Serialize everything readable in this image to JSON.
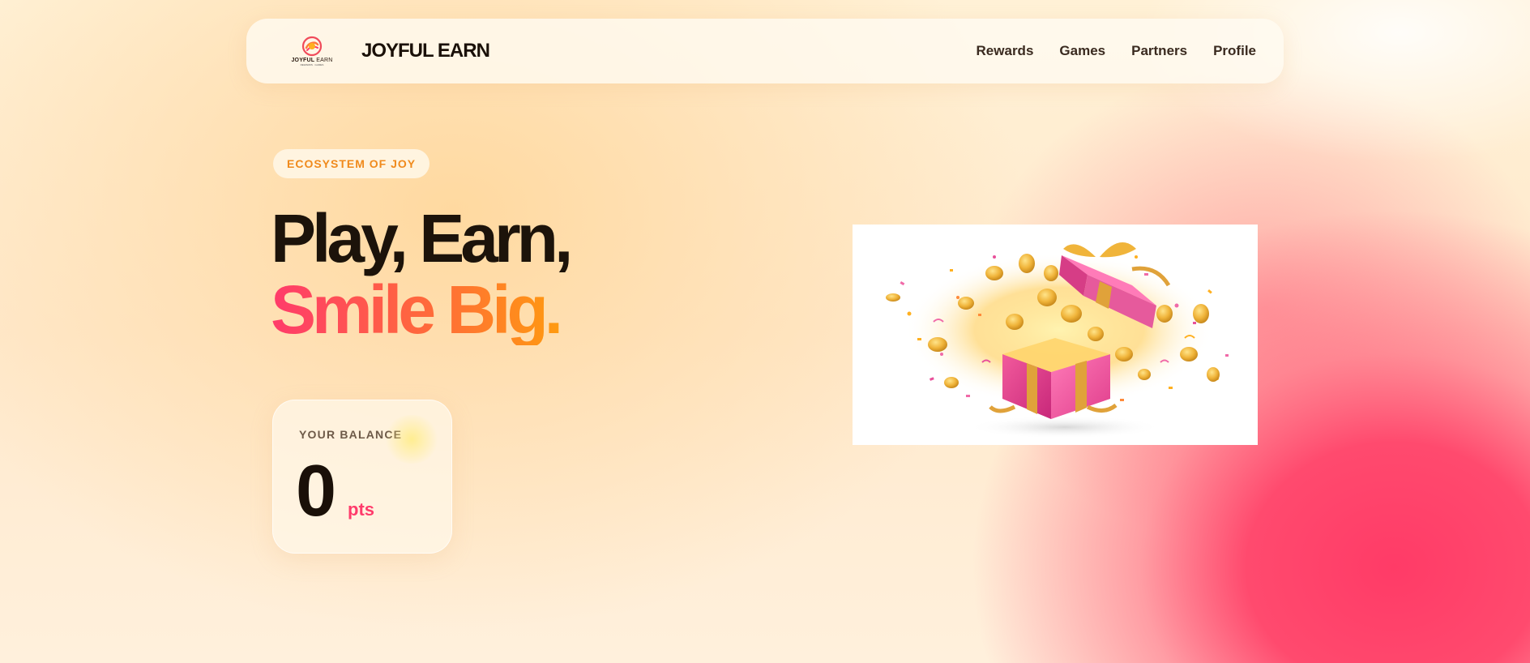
{
  "brand": {
    "logo_text_bold": "JOYFUL",
    "logo_text_light": "EARN",
    "logo_tagline": "REWARDS · GAMES",
    "name": "JOYFUL EARN"
  },
  "nav": {
    "items": [
      {
        "label": "Rewards"
      },
      {
        "label": "Games"
      },
      {
        "label": "Partners"
      },
      {
        "label": "Profile"
      }
    ]
  },
  "hero": {
    "badge": "ECOSYSTEM OF JOY",
    "headline_line1": "Play, Earn,",
    "headline_line2": "Smile Big."
  },
  "balance": {
    "label": "YOUR BALANCE",
    "value": "0",
    "unit": "pts"
  },
  "image": {
    "subject": "open-gift-box-with-coins-and-confetti"
  },
  "colors": {
    "accent_pink": "#ff3b6b",
    "accent_orange": "#ff9a10",
    "badge_orange": "#f08a1c",
    "text_dark": "#1c130a"
  }
}
